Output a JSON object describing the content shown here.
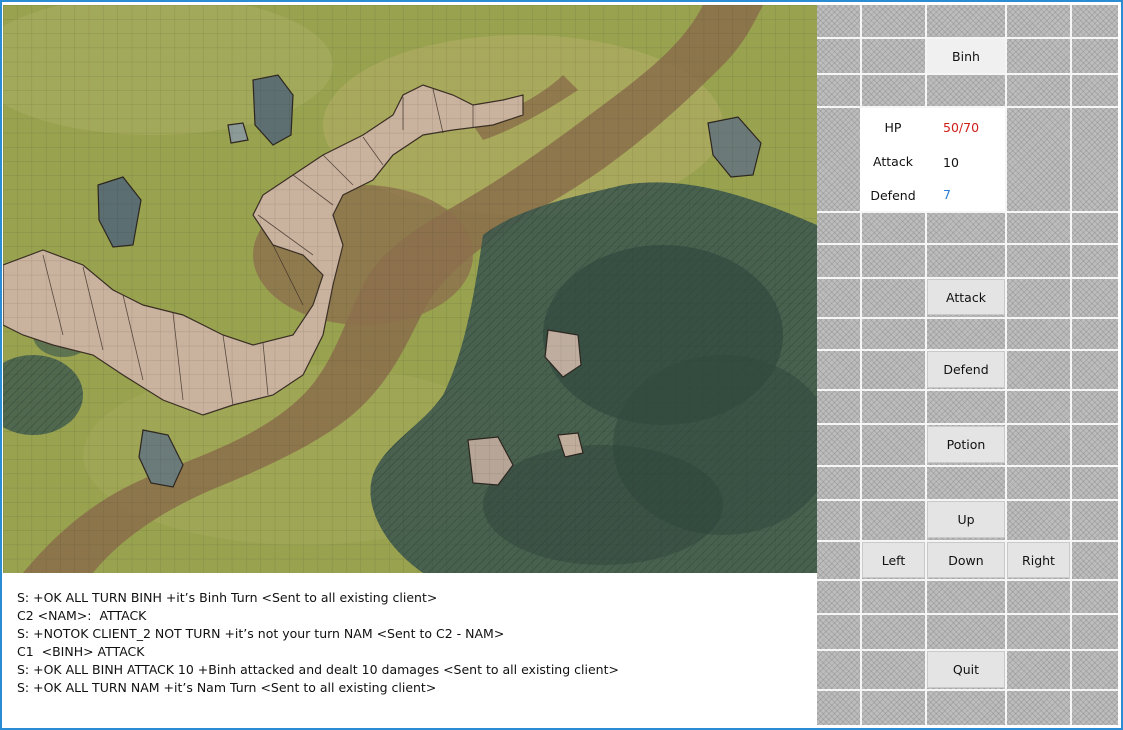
{
  "player": {
    "name": "Binh"
  },
  "stats": {
    "hp_label": "HP",
    "hp_value": "50/70",
    "hp_color": "#d0201a",
    "attack_label": "Attack",
    "attack_value": "10",
    "attack_color": "#111111",
    "defend_label": "Defend",
    "defend_value": "7",
    "defend_color": "#2a7fd4"
  },
  "actions": {
    "attack": "Attack",
    "defend": "Defend",
    "potion": "Potion",
    "up": "Up",
    "left": "Left",
    "down": "Down",
    "right": "Right",
    "quit": "Quit"
  },
  "log": [
    "S: +OK ALL TURN BINH +it’s Binh Turn <Sent to all existing client>",
    "C2 <NAM>:  ATTACK",
    "S: +NOTOK CLIENT_2 NOT TURN +it’s not your turn NAM <Sent to C2 - NAM>",
    "C1  <BINH> ATTACK",
    "S: +OK ALL BINH ATTACK 10 +Binh attacked and dealt 10 damages <Sent to all existing client>",
    "S: +OK ALL TURN NAM +it’s Nam Turn <Sent to all existing client>"
  ],
  "colors": {
    "frame": "#2b8cd6",
    "grass": "#9aa24e",
    "forest": "#3f5a4e",
    "path": "#8a6d4a",
    "rock": "#c9b29e"
  }
}
